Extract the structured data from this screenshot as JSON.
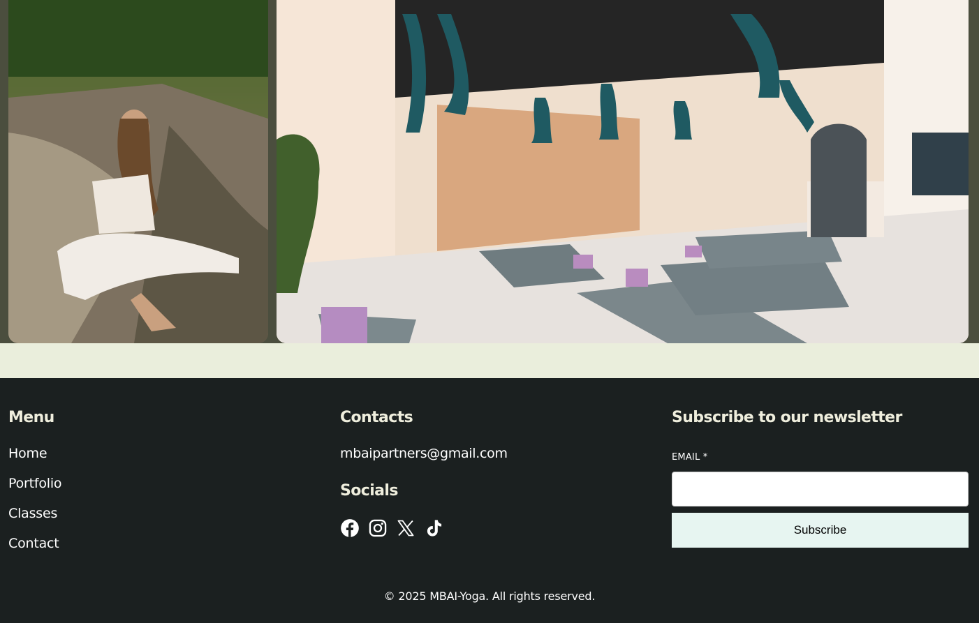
{
  "footer": {
    "menu": {
      "heading": "Menu",
      "items": [
        {
          "label": "Home"
        },
        {
          "label": "Portfolio"
        },
        {
          "label": "Classes"
        },
        {
          "label": "Contact"
        }
      ]
    },
    "contacts": {
      "heading": "Contacts",
      "email": "mbaipartners@gmail.com",
      "socials_heading": "Socials",
      "socials": [
        "facebook-icon",
        "instagram-icon",
        "x-icon",
        "tiktok-icon"
      ]
    },
    "newsletter": {
      "heading": "Subscribe to our newsletter",
      "email_label": "EMAIL *",
      "email_value": "",
      "button_label": "Subscribe"
    },
    "copyright": "© 2025 MBAI-Yoga. All rights reserved."
  },
  "colors": {
    "gallery_bg": "#4b4e3e",
    "band_bg": "#eaeedc",
    "footer_bg": "#1b2020",
    "heading_text": "#efeedd",
    "button_bg": "#e7f5f1"
  }
}
